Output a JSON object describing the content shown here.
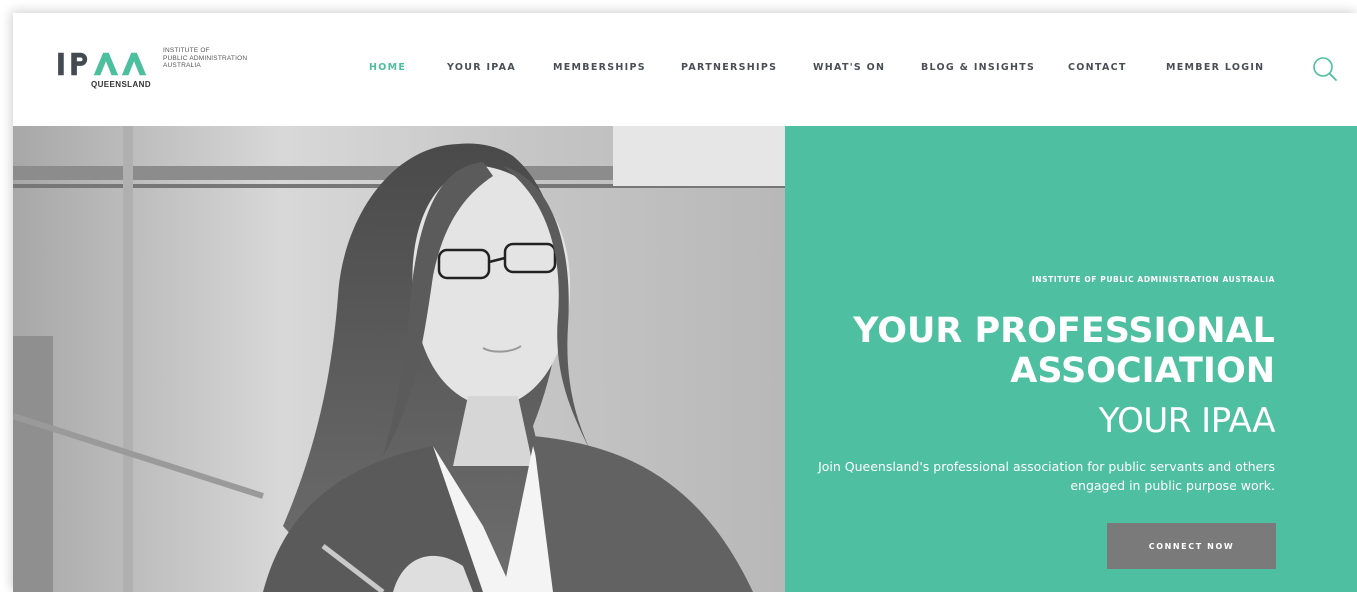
{
  "logo": {
    "mark": "IPAA",
    "sub": "QUEENSLAND",
    "line1": "INSTITUTE OF",
    "line2": "PUBLIC ADMINISTRATION",
    "line3": "AUSTRALIA"
  },
  "nav": {
    "items": [
      {
        "label": "HOME",
        "active": true
      },
      {
        "label": "YOUR IPAA",
        "active": false
      },
      {
        "label": "MEMBERSHIPS",
        "active": false
      },
      {
        "label": "PARTNERSHIPS",
        "active": false
      },
      {
        "label": "WHAT'S ON",
        "active": false
      },
      {
        "label": "BLOG & INSIGHTS",
        "active": false
      },
      {
        "label": "CONTACT",
        "active": false
      },
      {
        "label": "MEMBER LOGIN",
        "active": false
      }
    ],
    "search_icon": "search-icon"
  },
  "hero": {
    "eyebrow": "INSTITUTE OF PUBLIC ADMINISTRATION AUSTRALIA",
    "headline_line1": "YOUR PROFESSIONAL",
    "headline_line2": "ASSOCIATION",
    "subhead": "YOUR IPAA",
    "description": "Join Queensland's professional association for public servants and others engaged in public purpose work.",
    "cta_label": "CONNECT NOW"
  },
  "colors": {
    "accent": "#4cbf9f",
    "panel": "#4ebfa0",
    "nav_text": "#4a4f57",
    "cta_bg": "#7a7a7a"
  }
}
